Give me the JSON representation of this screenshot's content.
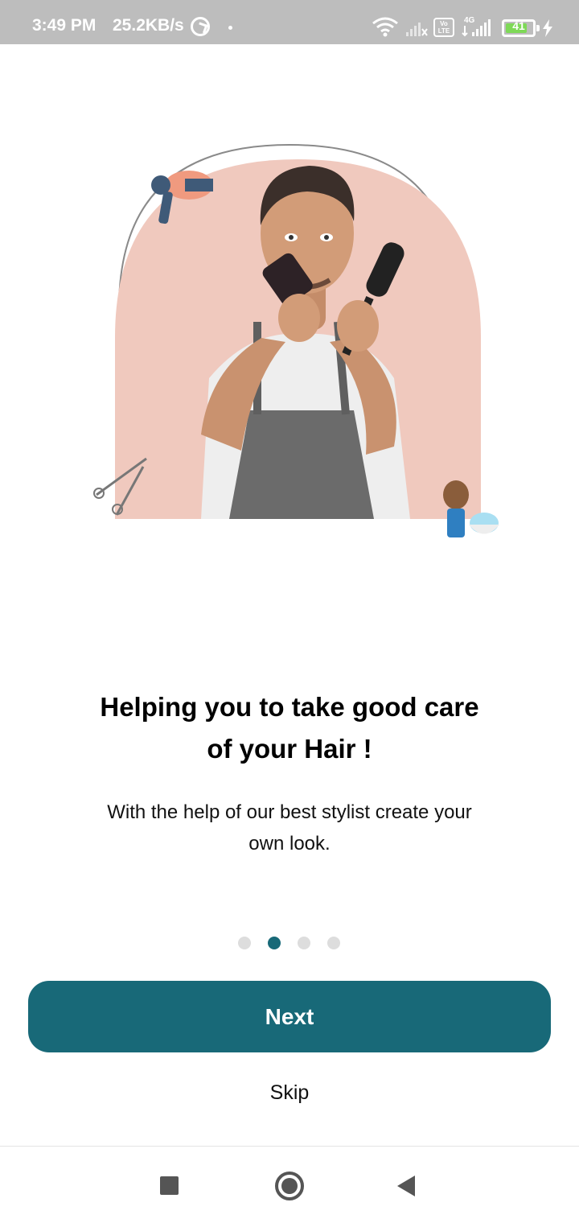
{
  "status_bar": {
    "time": "3:49 PM",
    "network_speed": "25.2KB/s",
    "battery_level": "41",
    "volte_label": "Vo LTE",
    "net_type": "4G",
    "icons": [
      "sync-icon",
      "dot-icon",
      "wifi-icon",
      "signal-icon",
      "volte-icon",
      "4g-signal-icon",
      "battery-icon",
      "charging-icon"
    ]
  },
  "onboarding": {
    "headline": "Helping you to take good care of your Hair !",
    "subtext": "With the help of our best stylist create your own look.",
    "page_count": 4,
    "active_page": 1
  },
  "actions": {
    "next_label": "Next",
    "skip_label": "Skip"
  },
  "nav_bar": {
    "icons": [
      "recents-icon",
      "home-icon",
      "back-icon"
    ]
  },
  "colors": {
    "primary": "#186978",
    "arch_background": "#f0c9be",
    "status_bar": "#bdbdbd",
    "dot_inactive": "#dddddd"
  }
}
